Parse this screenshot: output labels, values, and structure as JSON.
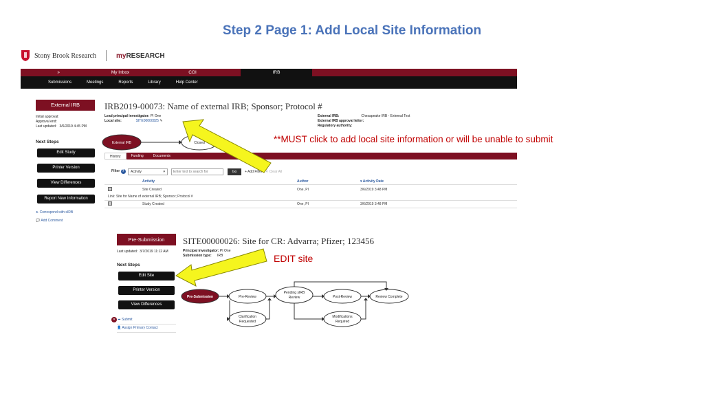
{
  "slide": {
    "title": "Step 2 Page 1: Add Local Site Information",
    "annotation_must": "**MUST click to add local site information or will be unable to submit",
    "annotation_edit": "EDIT site"
  },
  "brand": {
    "stony_brook": "Stony Brook Research",
    "my": "my",
    "research": "RESEARCH"
  },
  "topnav": [
    "»",
    "My Inbox",
    "COI",
    "IRB"
  ],
  "subnav": [
    "Submissions",
    "Meetings",
    "Reports",
    "Library",
    "Help Center"
  ],
  "shot1": {
    "state_banner": "External IRB",
    "meta_labels": [
      "Initial approval:",
      "Approval end:",
      "Last updated:"
    ],
    "last_updated": "3/6/2019 4:45 PM",
    "next_steps": "Next Steps",
    "buttons": [
      "Edit Study",
      "Printer Version",
      "View Differences",
      "Report New Information"
    ],
    "links": [
      "Correspond with sIRB",
      "Add Comment"
    ],
    "heading": "IRB2019-00073: Name of external IRB; Sponsor; Protocol #",
    "lead_pi_label": "Lead principal investigator:",
    "lead_pi_value": "PI One",
    "local_site_label": "Local site:",
    "local_site_value": "SITE00000025",
    "ext_irb_label": "External IRB:",
    "ext_irb_value": "Chesapeake IRB - External Test",
    "ext_letter_label": "External IRB approval letter:",
    "reg_auth_label": "Regulatory authority:",
    "wf_state1": "External IRB",
    "wf_state2": "Closed",
    "tabs": [
      "History",
      "Funding",
      "Documents"
    ],
    "filter_label": "Filter",
    "filter_select": "Activity",
    "filter_placeholder": "Enter text to search for",
    "go": "Go",
    "add_filter": "+ Add Filter",
    "clear_all": "✕ Clear All",
    "columns": [
      "Activity",
      "Author",
      "▾ Activity Date"
    ],
    "rows": [
      {
        "activity": "Site Created",
        "author": "One, PI",
        "date": "3/6/2019 3:48 PM"
      },
      {
        "activity": "Study Created",
        "author": "One, PI",
        "date": "3/6/2019 3:48 PM"
      }
    ],
    "link_row": "Link: Site for Name of external IRB; Sponsor; Protocol #"
  },
  "shot2": {
    "state_banner": "Pre-Submission",
    "last_updated_label": "Last updated:",
    "last_updated": "3/7/2019 11:12 AM",
    "next_steps": "Next Steps",
    "buttons": [
      "Edit Site",
      "Printer Version",
      "View Differences"
    ],
    "links": [
      "Submit",
      "Assign Primary Contact"
    ],
    "heading": "SITE00000026: Site for CR: Advarra; Pfizer; 123456",
    "pi_label": "Principal investigator:",
    "pi_value": "PI One",
    "sub_type_label": "Submission type:",
    "sub_type_value": "IRB",
    "workflow": {
      "pre_submission": "Pre-Submission",
      "pre_review": "Pre-Review",
      "pending_sirb_1": "Pending sIRB",
      "pending_sirb_2": "Review",
      "post_review": "Post-Review",
      "review_complete": "Review Complete",
      "clar_1": "Clarification",
      "clar_2": "Requested",
      "mod_1": "Modifications",
      "mod_2": "Required"
    }
  },
  "colors": {
    "maroon": "#7d1022",
    "title_blue": "#4a73b9",
    "annotation_red": "#c00000",
    "arrow_yellow": "#f5f51e"
  }
}
